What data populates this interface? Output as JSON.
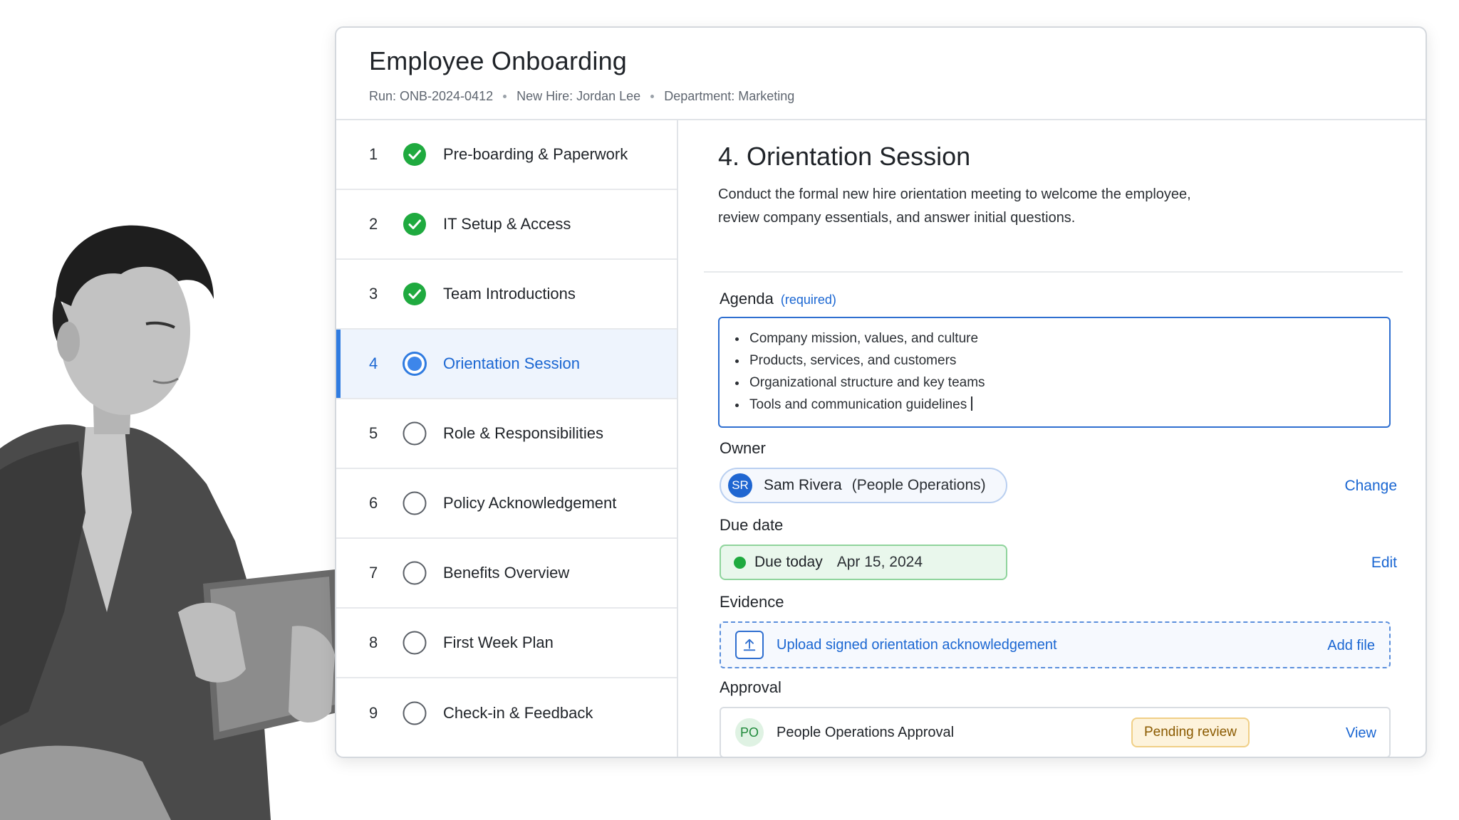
{
  "header": {
    "title": "Employee Onboarding",
    "run": "Run: ONB-2024-0412",
    "new_hire": "New Hire: Jordan Lee",
    "department": "Department: Marketing"
  },
  "steps": [
    {
      "num": "1",
      "label": "Pre-boarding & Paperwork",
      "status": "complete"
    },
    {
      "num": "2",
      "label": "IT Setup & Access",
      "status": "complete"
    },
    {
      "num": "3",
      "label": "Team Introductions",
      "status": "complete"
    },
    {
      "num": "4",
      "label": "Orientation Session",
      "status": "active"
    },
    {
      "num": "5",
      "label": "Role & Responsibilities",
      "status": "pending"
    },
    {
      "num": "6",
      "label": "Policy Acknowledgement",
      "status": "pending"
    },
    {
      "num": "7",
      "label": "Benefits Overview",
      "status": "pending"
    },
    {
      "num": "8",
      "label": "First Week Plan",
      "status": "pending"
    },
    {
      "num": "9",
      "label": "Check-in & Feedback",
      "status": "pending"
    }
  ],
  "detail": {
    "title": "4. Orientation Session",
    "description_line1": "Conduct the formal new hire orientation meeting to welcome the employee,",
    "description_line2": "review company essentials, and answer initial questions.",
    "agenda": {
      "label": "Agenda",
      "required": "(required)",
      "items": [
        "Company mission, values, and culture",
        "Products, services, and customers",
        "Organizational structure and key teams",
        "Tools and communication guidelines"
      ]
    },
    "owner": {
      "label": "Owner",
      "initials": "SR",
      "name": "Sam Rivera",
      "team": "(People Operations)",
      "action": "Change"
    },
    "due": {
      "label": "Due date",
      "status": "Due today",
      "date": "Apr 15, 2024",
      "action": "Edit"
    },
    "evidence": {
      "label": "Evidence",
      "text": "Upload signed orientation acknowledgement",
      "action": "Add file"
    },
    "approval": {
      "label": "Approval",
      "initials": "PO",
      "name": "People Operations Approval",
      "status": "Pending review",
      "action": "View"
    }
  },
  "colors": {
    "accent": "#1a66d2",
    "complete": "#1faa3f",
    "pending_badge": "#fdf3dc"
  },
  "icons": {
    "complete": "check-circle-icon",
    "active": "radio-selected-icon",
    "pending": "empty-circle-icon",
    "upload": "upload-icon"
  }
}
